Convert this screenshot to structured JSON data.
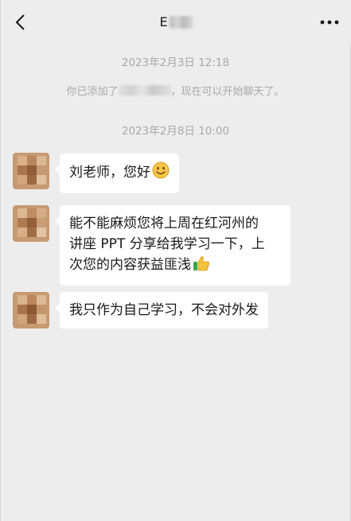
{
  "header": {
    "title_visible": "E",
    "back_icon": "chevron-left-icon",
    "more_icon": "more-dots-icon"
  },
  "messages": {
    "ts1": "2023年2月3日 12:18",
    "system_prefix": "你已添加了",
    "system_suffix": "，现在可以开始聊天了。",
    "ts2": "2023年2月8日 10:00",
    "msg1": "刘老师，您好",
    "msg1_emoji": "smile-emoji",
    "msg2_line1": "能不能麻烦您将上周在红河州的",
    "msg2_line2": "讲座 PPT 分享给我学习一下，上",
    "msg2_line3": "次您的内容获益匪浅",
    "msg2_emoji": "thumbs-up-emoji",
    "msg3": "我只作为自己学习，不会对外发"
  },
  "colors": {
    "background": "#ededed",
    "bubble": "#ffffff",
    "meta_text": "#a9a9a9",
    "text": "#191919"
  }
}
